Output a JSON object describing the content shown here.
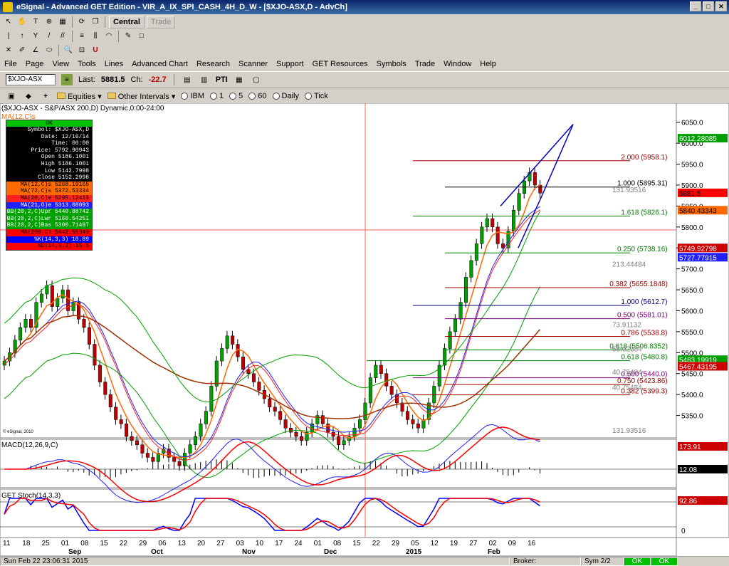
{
  "window": {
    "title": "eSignal - Advanced GET Edition - VIR_A_IX_SPI_CASH_4H_D_W - [$XJO-ASX,D - AdvCh]",
    "min": "_",
    "max": "□",
    "close": "✕"
  },
  "toolbar1": {
    "central": "Central",
    "trade": "Trade"
  },
  "menu": [
    "File",
    "Page",
    "View",
    "Tools",
    "Lines",
    "Advanced Chart",
    "Research",
    "Scanner",
    "Support",
    "GET Resources",
    "Symbols",
    "Trade",
    "Window",
    "Help"
  ],
  "symbol_bar": {
    "symbol": "$XJO-ASX",
    "last_label": "Last:",
    "last": "5881.5",
    "ch_label": "Ch:",
    "ch": "-22.7",
    "pti": "PTI"
  },
  "interval_bar": {
    "equities": "Equities",
    "other": "Other Intervals",
    "intervals": [
      "IBM",
      "1",
      "5",
      "60",
      "Daily",
      "Tick"
    ]
  },
  "status": {
    "datetime": "Sun Feb 22 23:06:31 2015",
    "broker": "Broker:",
    "sym": "Sym 2/2",
    "ok1": "OK",
    "ok2": "OK"
  },
  "cursor_box": {
    "ok": "OK",
    "rows": [
      {
        "t": "Symbol: $XJO-ASX,D",
        "bg": "#000000",
        "fg": "#ffffff"
      },
      {
        "t": "Date: 12/16/14",
        "bg": "#000000",
        "fg": "#ffffff"
      },
      {
        "t": "Time: 00:00",
        "bg": "#000000",
        "fg": "#ffffff"
      },
      {
        "t": "Price: 5792.90943",
        "bg": "#000000",
        "fg": "#ffffff"
      },
      {
        "t": "Open 5186.1001",
        "bg": "#000000",
        "fg": "#ffffff"
      },
      {
        "t": "High 5186.1001",
        "bg": "#000000",
        "fg": "#ffffff"
      },
      {
        "t": "Low 5142.7998",
        "bg": "#000000",
        "fg": "#ffffff"
      },
      {
        "t": "Close 5152.2998",
        "bg": "#000000",
        "fg": "#ffffff"
      },
      {
        "t": "MA(12,C)s 5268.19165",
        "bg": "#ff6a00",
        "fg": "#000000"
      },
      {
        "t": "MA(72,C)s 5372.53334",
        "bg": "#ff6a00",
        "fg": "#000000"
      },
      {
        "t": "MA(20,C)e 5295.12415",
        "bg": "#ff2020",
        "fg": "#000000"
      },
      {
        "t": "MA(21,O)e 5313.08093",
        "bg": "#2020ff",
        "fg": "#ffffff"
      },
      {
        "t": "BB(20,2,C)Upr 5440.88742",
        "bg": "#00a000",
        "fg": "#ffffff"
      },
      {
        "t": "BB(20,2,C)Lwr 5160.54251",
        "bg": "#00a000",
        "fg": "#ffffff"
      },
      {
        "t": "BB(20,2,C)Bas 5300.71497",
        "bg": "#00a000",
        "fg": "#ffffff"
      },
      {
        "t": "MA(200,C) 5442.55349",
        "bg": "#ff0000",
        "fg": "#000000"
      },
      {
        "t": "%K(14,3,3) 10.89",
        "bg": "#0000ff",
        "fg": "#ffffff"
      },
      {
        "t": "%D(14,3,3) 15.5",
        "bg": "#ff0000",
        "fg": "#000000"
      }
    ]
  },
  "chart_data": {
    "type": "candlestick",
    "title": "($XJO-ASX - S&P/ASX 200,D) Dynamic,0:00-24:00",
    "indicator_label": "MA(12,C)s",
    "copyright": "© eSignal, 2010",
    "ylim": [
      5300,
      6075
    ],
    "y_ticks": [
      5350,
      5400,
      5450,
      5500,
      5550,
      5600,
      5650,
      5700,
      5750,
      5800,
      5850,
      5900,
      5950,
      6000,
      6050
    ],
    "x_day_labels": [
      "11",
      "18",
      "25",
      "01",
      "08",
      "15",
      "22",
      "29",
      "06",
      "13",
      "20",
      "27",
      "03",
      "10",
      "17",
      "24",
      "01",
      "08",
      "15",
      "22",
      "29",
      "05",
      "12",
      "19",
      "27",
      "02",
      "09",
      "16"
    ],
    "x_month_labels": [
      "Sep",
      "Oct",
      "Nov",
      "Dec",
      "2015",
      "Feb"
    ],
    "closes": [
      5480,
      5500,
      5530,
      5560,
      5580,
      5560,
      5620,
      5640,
      5660,
      5610,
      5630,
      5650,
      5600,
      5620,
      5580,
      5560,
      5520,
      5470,
      5430,
      5400,
      5370,
      5340,
      5330,
      5300,
      5290,
      5280,
      5260,
      5250,
      5240,
      5260,
      5270,
      5250,
      5240,
      5230,
      5260,
      5280,
      5300,
      5330,
      5360,
      5420,
      5480,
      5510,
      5540,
      5520,
      5490,
      5460,
      5450,
      5430,
      5410,
      5390,
      5370,
      5360,
      5340,
      5320,
      5310,
      5300,
      5290,
      5310,
      5330,
      5350,
      5330,
      5310,
      5300,
      5280,
      5290,
      5300,
      5320,
      5340,
      5380,
      5440,
      5470,
      5450,
      5420,
      5400,
      5380,
      5360,
      5340,
      5330,
      5320,
      5340,
      5380,
      5420,
      5470,
      5510,
      5550,
      5580,
      5620,
      5680,
      5720,
      5760,
      5800,
      5820,
      5800,
      5760,
      5750,
      5790,
      5840,
      5880,
      5910,
      5930,
      5900,
      5881
    ],
    "price_labels": [
      {
        "value": "6012.28085",
        "price": 6012,
        "bg": "#00a000",
        "fg": "#ffffff"
      },
      {
        "value": "5881.5",
        "price": 5881.5,
        "bg": "#ff0000",
        "fg": "#000000"
      },
      {
        "value": "5840.43343",
        "price": 5840,
        "bg": "#ff6a00",
        "fg": "#000000"
      },
      {
        "value": "5749.92798",
        "price": 5749.9,
        "bg": "#cc0000",
        "fg": "#ffffff"
      },
      {
        "value": "5727.77915",
        "price": 5727.8,
        "bg": "#2020ff",
        "fg": "#ffffff"
      },
      {
        "value": "5483.19919",
        "price": 5483.2,
        "bg": "#00a000",
        "fg": "#ffffff"
      },
      {
        "value": "5467.43195",
        "price": 5467.4,
        "bg": "#cc0000",
        "fg": "#ffffff"
      }
    ],
    "fib_levels": [
      {
        "label": "2.000 (5958.1)",
        "price": 5958.1,
        "color": "#a00000",
        "x0": 580
      },
      {
        "label": "1.000 (5895.31)",
        "price": 5895.31,
        "color": "#000000",
        "x0": 625
      },
      {
        "label": "1.618 (5826.1)",
        "price": 5826.1,
        "color": "#008000",
        "x0": 580
      },
      {
        "label": "0.250 (5738.16)",
        "price": 5738.16,
        "color": "#008000",
        "x0": 625
      },
      {
        "label": "0.382 (5655.1848)",
        "price": 5655.18,
        "color": "#a00000",
        "x0": 625
      },
      {
        "label": "1.000 (5612.7)",
        "price": 5612.7,
        "color": "#000080",
        "x0": 580
      },
      {
        "label": "0.500 (5581.01)",
        "price": 5581.01,
        "color": "#800080",
        "x0": 625
      },
      {
        "label": "0.786 (5538.8)",
        "price": 5538.8,
        "color": "#a00000",
        "x0": 625
      },
      {
        "label": "0.618 (5506.8352)",
        "price": 5506.8,
        "color": "#008000",
        "x0": 625
      },
      {
        "label": "0.618 (5480.8)",
        "price": 5480.8,
        "color": "#008000",
        "x0": 515
      },
      {
        "label": "0.500 (5440.0)",
        "price": 5440,
        "color": "#800080",
        "x0": 580
      },
      {
        "label": "0.750 (5423.86)",
        "price": 5423.86,
        "color": "#a00000",
        "x0": 625
      },
      {
        "label": "0.382 (5399.3)",
        "price": 5399.3,
        "color": "#a00000",
        "x0": 580
      }
    ],
    "time_labels": [
      {
        "label": "131.93516",
        "price": 5890
      },
      {
        "label": "213.44484",
        "price": 5712
      },
      {
        "label": "73.91132",
        "price": 5568
      },
      {
        "label": "58.02384",
        "price": 5510
      },
      {
        "label": "40.75484",
        "price": 5455
      },
      {
        "label": "40.75484",
        "price": 5418
      },
      {
        "label": "131.93516",
        "price": 5315
      }
    ],
    "macd": {
      "label": "MACD(12,26,9,C)",
      "value1": "173.91",
      "value2": "12.08"
    },
    "stoch": {
      "label": "GET Stoch(14,3,3)",
      "value1": "92.86",
      "value2": "0"
    }
  }
}
